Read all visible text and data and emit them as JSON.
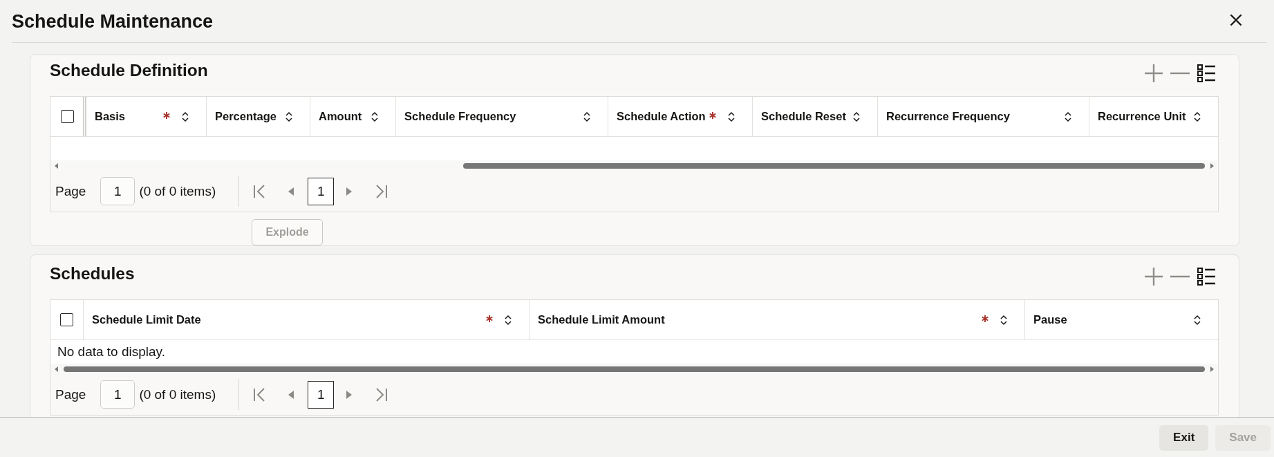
{
  "window": {
    "title": "Schedule Maintenance"
  },
  "sections": [
    {
      "title": "Schedule Definition",
      "toolbar": [
        {
          "kind": "add",
          "disabled": true
        },
        {
          "kind": "remove",
          "disabled": true
        },
        {
          "kind": "columns",
          "disabled": false
        }
      ],
      "table": {
        "select_all_checked": false,
        "select_column_frozen": true,
        "columns": [
          {
            "label": "Basis",
            "required": true
          },
          {
            "label": "Percentage",
            "required": false
          },
          {
            "label": "Amount",
            "required": false
          },
          {
            "label": "Schedule Frequency",
            "required": false
          },
          {
            "label": "Schedule Action",
            "required": true
          },
          {
            "label": "Schedule Reset",
            "required": false
          },
          {
            "label": "Recurrence Frequency",
            "required": false
          },
          {
            "label": "Recurrence Unit",
            "required": false
          }
        ]
      },
      "pagination": {
        "label": "Page",
        "page_input": "1",
        "summary": "(0 of 0 items)",
        "nav": [
          {
            "kind": "first",
            "disabled": true
          },
          {
            "kind": "previous",
            "disabled": true
          },
          {
            "kind": "next",
            "disabled": true
          },
          {
            "kind": "last",
            "disabled": true
          }
        ],
        "pages": [
          {
            "label": "1",
            "selected": true
          }
        ]
      },
      "actions": [
        {
          "label": "Explode",
          "disabled": true
        }
      ]
    },
    {
      "title": "Schedules",
      "toolbar": [
        {
          "kind": "add",
          "disabled": true
        },
        {
          "kind": "remove",
          "disabled": true
        },
        {
          "kind": "columns",
          "disabled": false
        }
      ],
      "table": {
        "select_all_checked": false,
        "select_column_frozen": false,
        "columns": [
          {
            "label": "Schedule Limit Date",
            "required": true
          },
          {
            "label": "Schedule Limit Amount",
            "required": true
          },
          {
            "label": "Pause",
            "required": false
          }
        ],
        "empty_message": "No data to display."
      },
      "pagination": {
        "label": "Page",
        "page_input": "1",
        "summary": "(0 of 0 items)",
        "nav": [
          {
            "kind": "first",
            "disabled": true
          },
          {
            "kind": "previous",
            "disabled": true
          },
          {
            "kind": "next",
            "disabled": true
          },
          {
            "kind": "last",
            "disabled": true
          }
        ],
        "pages": [
          {
            "label": "1",
            "selected": true
          }
        ]
      }
    }
  ],
  "footer": {
    "buttons": [
      {
        "label": "Exit",
        "disabled": false
      },
      {
        "label": "Save",
        "disabled": true
      }
    ]
  }
}
